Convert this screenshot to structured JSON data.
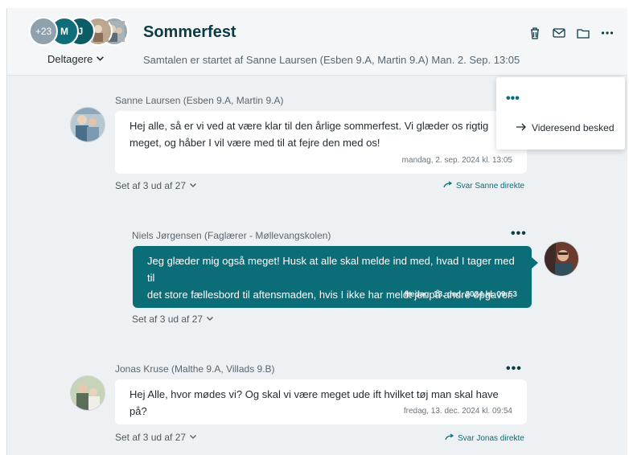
{
  "header": {
    "avatars": [
      {
        "label": "+23"
      },
      {
        "label": "M"
      },
      {
        "label": "J"
      }
    ],
    "participants_label": "Deltagere",
    "title": "Sommerfest",
    "subtitle": "Samtalen er startet af Sanne Laursen (Esben 9.A, Martin 9.A) Man. 2. Sep. 13:05",
    "icons": [
      "trash-icon",
      "mail-icon",
      "folder-icon",
      "more-icon"
    ]
  },
  "messages": [
    {
      "sender": "Sanne Laursen (Esben 9.A, Martin 9.A)",
      "lines": [
        "Hej alle, så er vi ved at være klar til den årlige sommerfest. Vi glæder os rigtig",
        "meget, og håber I vil være med til at fejre den med os!"
      ],
      "timestamp": "mandag, 2. sep. 2024 kl. 13:05",
      "seen": "Set af 3 ud af 27",
      "reply": "Svar Sanne direkte"
    },
    {
      "sender": "Niels Jørgensen (Faglærer - Møllevangskolen)",
      "lines": [
        "Jeg glæder mig også meget! Husk at alle skal melde ind med, hvad I tager med til",
        "det store fællesbord til aftensmaden, hvis I ikke har meldt jer på andre opgaver."
      ],
      "timestamp": "fredag, 13. dec. 2024 kl. 09:53",
      "seen": "Set af 3 ud af 27"
    },
    {
      "sender": "Jonas Kruse (Malthe 9.A, Villads 9.B)",
      "lines": [
        "Hej Alle, hvor mødes vi? Og skal vi være meget ude ift hvilket tøj man skal have på?"
      ],
      "timestamp": "fredag, 13. dec. 2024 kl. 09:54",
      "seen": "Set af 3 ud af 27",
      "reply": "Svar Jonas direkte"
    }
  ],
  "popup": {
    "forward_label": "Videresend besked"
  },
  "colors": {
    "accent": "#0b6d78",
    "title": "#0c3b45",
    "background": "#eef1f3"
  }
}
